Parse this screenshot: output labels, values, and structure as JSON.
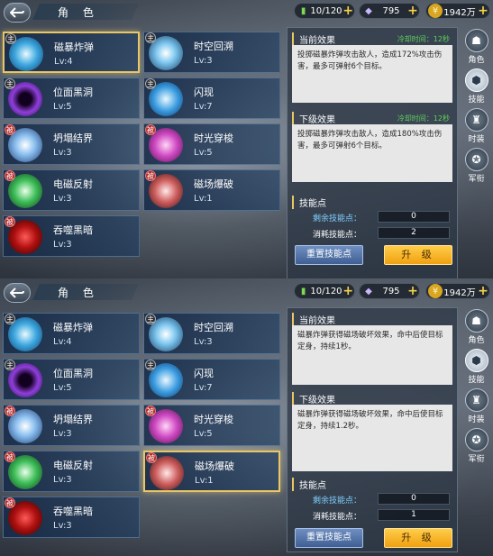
{
  "colors": {
    "accent": "#e9c766",
    "cooldown": "#5fd15f",
    "upgrade": "#f0a010",
    "reset": "#4f70a8"
  },
  "screens": [
    {
      "title": "角 色",
      "resources": [
        {
          "icon": "energy-potion-icon",
          "value": "10/120"
        },
        {
          "icon": "diamond-icon",
          "value": "795"
        },
        {
          "icon": "gold-coin-icon",
          "value": "1942万"
        }
      ],
      "skills": [
        {
          "name": "磁暴炸弹",
          "level": "Lv:4",
          "badge": "主",
          "selected": true
        },
        {
          "name": "时空回溯",
          "level": "Lv:3",
          "badge": "主"
        },
        {
          "name": "位面黑洞",
          "level": "Lv:5",
          "badge": "主"
        },
        {
          "name": "闪现",
          "level": "Lv:7",
          "badge": "主"
        },
        {
          "name": "坍塌结界",
          "level": "Lv:3",
          "badge": "被"
        },
        {
          "name": "时光穿梭",
          "level": "Lv:5",
          "badge": "被"
        },
        {
          "name": "电磁反射",
          "level": "Lv:3",
          "badge": "被"
        },
        {
          "name": "磁场爆破",
          "level": "Lv:1",
          "badge": "被"
        },
        {
          "name": "吞噬黑暗",
          "level": "Lv:3",
          "badge": "被"
        }
      ],
      "panel": {
        "current_title": "当前效果",
        "current_cd": "冷却时间：12秒",
        "current_desc": "投掷磁暴炸弹攻击敌人，造成172%攻击伤害，最多可弹射6个目标。",
        "next_title": "下级效果",
        "next_cd": "冷却时间：12秒",
        "next_desc": "投掷磁暴炸弹攻击敌人，造成180%攻击伤害，最多可弹射6个目标。",
        "points_title": "技能点",
        "remaining_label": "剩余技能点：",
        "remaining_value": "0",
        "cost_label": "消耗技能点：",
        "cost_value": "2",
        "reset_label": "重置技能点",
        "upgrade_label": "升 级"
      }
    },
    {
      "title": "角 色",
      "resources": [
        {
          "icon": "energy-potion-icon",
          "value": "10/120"
        },
        {
          "icon": "diamond-icon",
          "value": "795"
        },
        {
          "icon": "gold-coin-icon",
          "value": "1942万"
        }
      ],
      "skills": [
        {
          "name": "磁暴炸弹",
          "level": "Lv:4",
          "badge": "主"
        },
        {
          "name": "时空回溯",
          "level": "Lv:3",
          "badge": "主"
        },
        {
          "name": "位面黑洞",
          "level": "Lv:5",
          "badge": "主"
        },
        {
          "name": "闪现",
          "level": "Lv:7",
          "badge": "主"
        },
        {
          "name": "坍塌结界",
          "level": "Lv:3",
          "badge": "被"
        },
        {
          "name": "时光穿梭",
          "level": "Lv:5",
          "badge": "被"
        },
        {
          "name": "电磁反射",
          "level": "Lv:3",
          "badge": "被"
        },
        {
          "name": "磁场爆破",
          "level": "Lv:1",
          "badge": "被",
          "selected": true
        },
        {
          "name": "吞噬黑暗",
          "level": "Lv:3",
          "badge": "被"
        }
      ],
      "panel": {
        "current_title": "当前效果",
        "current_cd": "",
        "current_desc": "磁暴炸弹获得磁场破坏效果，命中后使目标定身，持续1秒。",
        "next_title": "下级效果",
        "next_cd": "",
        "next_desc": "磁暴炸弹获得磁场破坏效果，命中后使目标定身，持续1.2秒。",
        "points_title": "技能点",
        "remaining_label": "剩余技能点：",
        "remaining_value": "0",
        "cost_label": "消耗技能点：",
        "cost_value": "1",
        "reset_label": "重置技能点",
        "upgrade_label": "升 级"
      }
    }
  ],
  "side_tabs": [
    {
      "label": "角色",
      "icon": "character-helmet-icon"
    },
    {
      "label": "技能",
      "icon": "skill-hex-icon",
      "active": true
    },
    {
      "label": "时装",
      "icon": "costume-armor-icon"
    },
    {
      "label": "军衔",
      "icon": "rank-medal-icon"
    }
  ]
}
